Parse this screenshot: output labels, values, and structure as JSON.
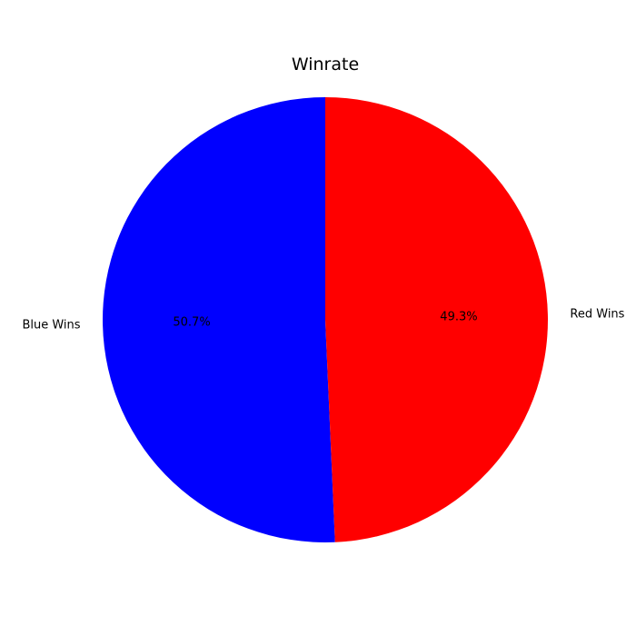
{
  "chart_data": {
    "type": "pie",
    "title": "Winrate",
    "slices": [
      {
        "label": "Blue Wins",
        "value": 50.7,
        "pct_label": "50.7%",
        "color": "#0000ff"
      },
      {
        "label": "Red Wins",
        "value": 49.3,
        "pct_label": "49.3%",
        "color": "#ff0000"
      }
    ],
    "start_angle_deg": 90,
    "direction": "counterclockwise"
  }
}
